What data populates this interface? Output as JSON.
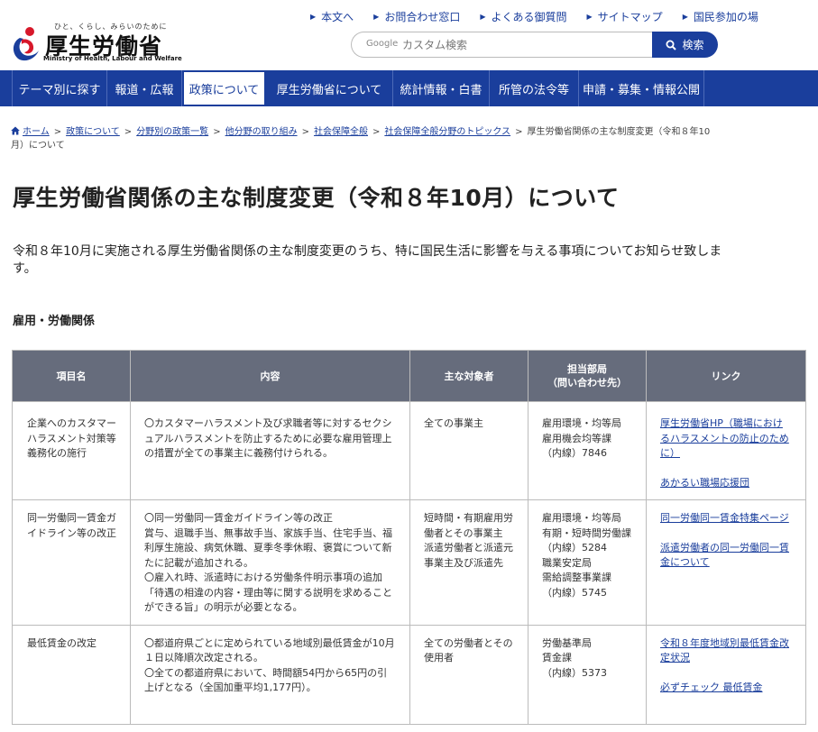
{
  "header": {
    "logo_tagline": "ひと、くらし、みらいのために",
    "logo_name": "厚生労働省",
    "logo_en": "Ministry of Health, Labour and Welfare",
    "util_links": [
      "本文へ",
      "お問合わせ窓口",
      "よくある御質問",
      "サイトマップ",
      "国民参加の場"
    ],
    "search_brand": "Google",
    "search_placeholder": "カスタム検索",
    "search_button": "検索"
  },
  "nav": [
    "テーマ別に探す",
    "報道・広報",
    "政策について",
    "厚生労働省について",
    "統計情報・白書",
    "所管の法令等",
    "申請・募集・情報公開"
  ],
  "breadcrumb": [
    "ホーム",
    "政策について",
    "分野別の政策一覧",
    "他分野の取り組み",
    "社会保障全般",
    "社会保障全般分野のトピックス",
    "厚生労働省関係の主な制度変更（令和８年10月）について"
  ],
  "page": {
    "title": "厚生労働省関係の主な制度変更（令和８年10月）について",
    "lead": "令和８年10月に実施される厚生労働省関係の主な制度変更のうち、特に国民生活に影響を与える事項についてお知らせ致します。",
    "section": "雇用・労働関係"
  },
  "table": {
    "headers": [
      "項目名",
      "内容",
      "主な対象者",
      "担当部局\n（問い合わせ先）",
      "リンク"
    ],
    "rows": [
      {
        "item": "企業へのカスタマーハラスメント対策等義務化の施行",
        "content": "〇カスタマーハラスメント及び求職者等に対するセクシュアルハラスメントを防止するために必要な雇用管理上の措置が全ての事業主に義務付けられる。",
        "target": "全ての事業主",
        "dept": "雇用環境・均等局\n雇用機会均等課\n（内線）7846",
        "links": [
          "厚生労働省HP（職場におけるハラスメントの防止のために）",
          "あかるい職場応援団"
        ]
      },
      {
        "item": "同一労働同一賃金ガイドライン等の改正",
        "content": "〇同一労働同一賃金ガイドライン等の改正\n賞与、退職手当、無事故手当、家族手当、住宅手当、福利厚生施設、病気休職、夏季冬季休暇、褒賞について新たに記載が追加される。\n〇雇入れ時、派遣時における労働条件明示事項の追加\n「待遇の相違の内容・理由等に関する説明を求めることができる旨」の明示が必要となる。",
        "target": "短時間・有期雇用労働者とその事業主\n派遣労働者と派遣元事業主及び派遣先",
        "dept": "雇用環境・均等局\n有期・短時間労働課\n（内線）5284\n職業安定局\n需給調整事業課\n（内線）5745",
        "links": [
          "同一労働同一賃金特集ページ",
          "派遣労働者の同一労働同一賃金について"
        ]
      },
      {
        "item": "最低賃金の改定",
        "content": "〇都道府県ごとに定められている地域別最低賃金が10月１日以降順次改定される。\n〇全ての都道府県において、時間額54円から65円の引上げとなる（全国加重平均1,177円）。",
        "target": "全ての労働者とその使用者",
        "dept": "労働基準局\n賃金課\n（内線）5373",
        "links": [
          "令和８年度地域別最低賃金改定状況",
          "必ずチェック 最低賃金"
        ]
      }
    ]
  },
  "colors": {
    "brand_blue": "#1a3e9c",
    "table_header": "#666c7c",
    "logo_red": "#d7182a"
  }
}
